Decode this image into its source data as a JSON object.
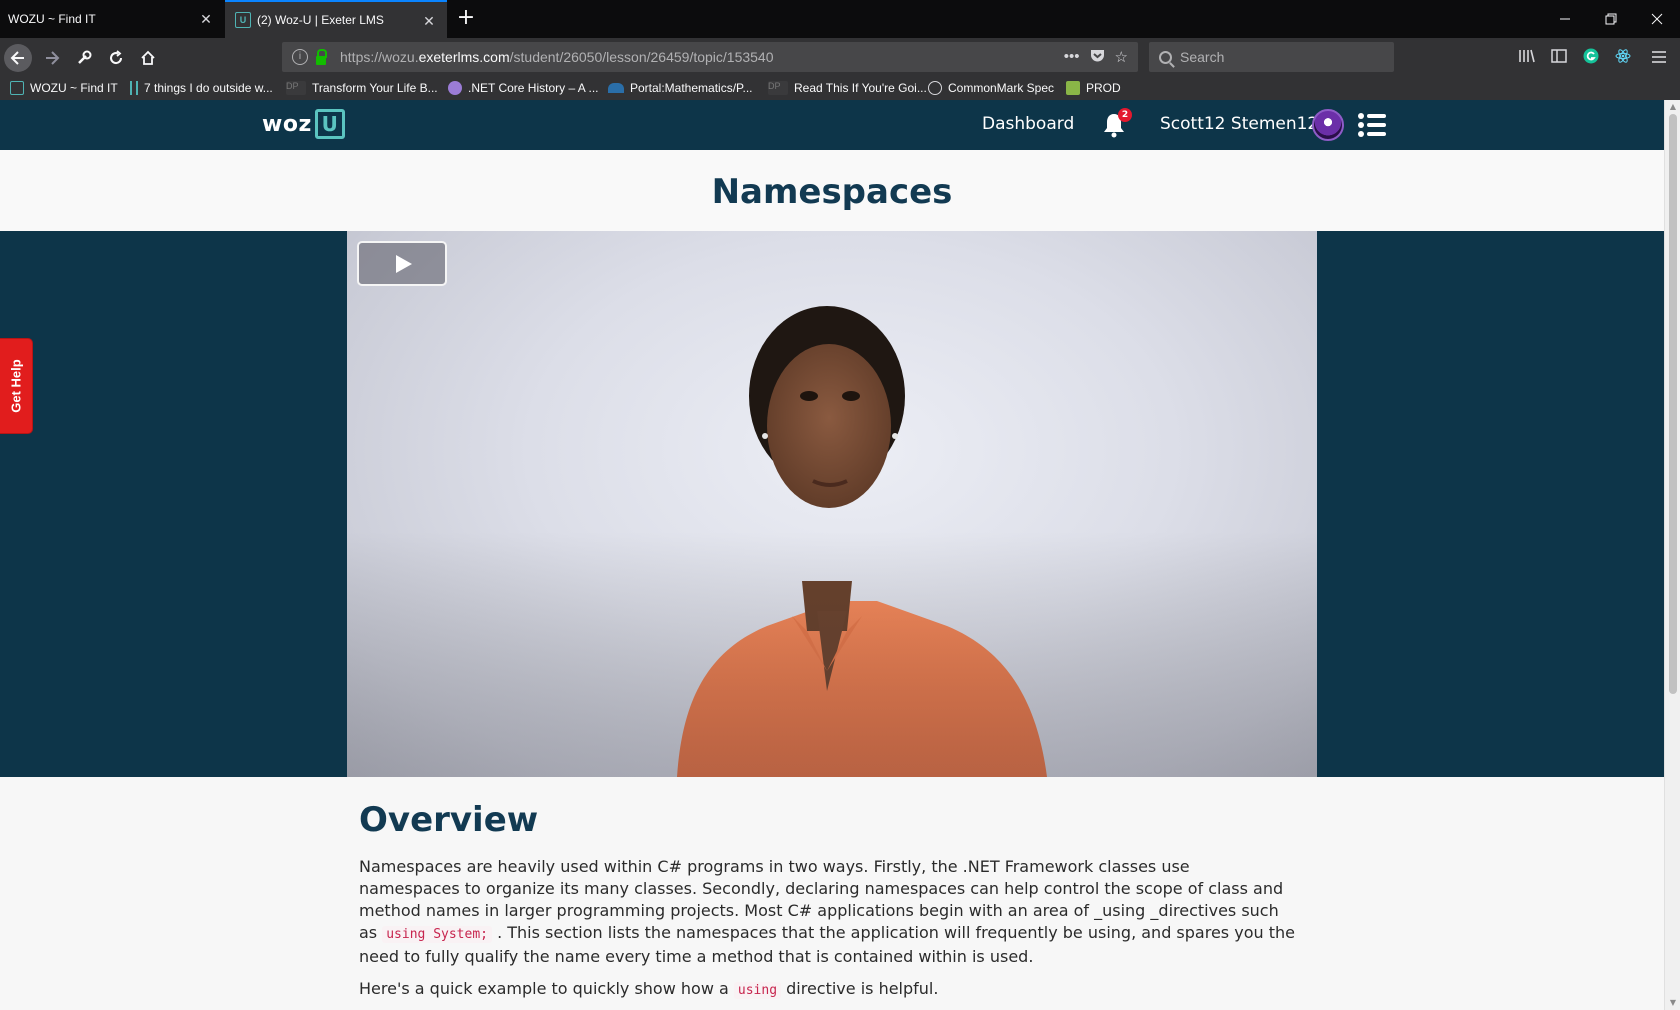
{
  "browser": {
    "tabs": [
      {
        "title": "WOZU ~ Find IT",
        "active": false
      },
      {
        "title": "(2) Woz-U | Exeter LMS",
        "active": true
      }
    ],
    "url": {
      "prefix": "https://wozu.",
      "host": "exeterlms.com",
      "path": "/student/26050/lesson/26459/topic/153540"
    },
    "search_placeholder": "Search",
    "bookmarks": [
      {
        "label": "WOZU ~ Find IT",
        "icon": "wozu-icon"
      },
      {
        "label": "7 things I do outside w...",
        "icon": "ladder-icon"
      },
      {
        "label": "Transform Your Life B...",
        "icon": "dp-icon"
      },
      {
        "label": ".NET Core History – A ...",
        "icon": "potion-icon"
      },
      {
        "label": "Portal:Mathematics/P...",
        "icon": "wiki-icon"
      },
      {
        "label": "Read This If You're Goi...",
        "icon": "dp-icon"
      },
      {
        "label": "CommonMark Spec",
        "icon": "globe-icon"
      },
      {
        "label": "PROD",
        "icon": "prod-icon"
      }
    ]
  },
  "site": {
    "logo_text": "woz",
    "logo_u": "U",
    "nav_dashboard": "Dashboard",
    "notification_count": "2",
    "user_name": "Scott12 Stemen12"
  },
  "lesson": {
    "title": "Namespaces",
    "get_help": "Get Help",
    "overview_heading": "Overview",
    "para1_a": "Namespaces are heavily used within C# programs in two ways. Firstly, the .NET Framework classes use namespaces to organize its many classes. Secondly, declaring namespaces can help control the scope of class and method names in larger programming projects. Most C# applications begin with an area of _using _directives such as ",
    "para1_code": "using System;",
    "para1_b": " . This section lists the namespaces that the application will frequently be using, and spares you the need to fully qualify the name every time a method that is contained within is used.",
    "para2_a": "Here's a quick example to quickly show how a ",
    "para2_code": "using",
    "para2_b": " directive is helpful."
  },
  "colors": {
    "header_bg": "#0d3549",
    "accent_teal": "#5bc4c0",
    "help_red": "#e11d1d",
    "title_blue": "#123a52"
  }
}
